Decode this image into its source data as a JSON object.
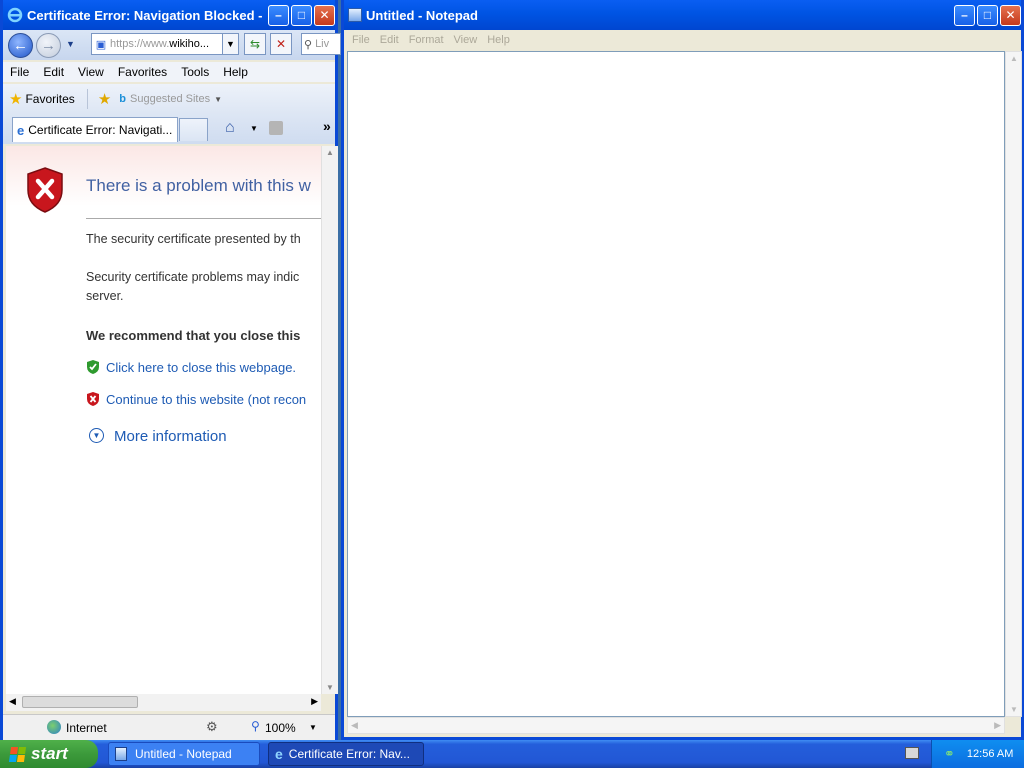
{
  "ie": {
    "title": "Certificate Error: Navigation Blocked - Win...",
    "address": {
      "prefix": "https://www.",
      "domain": "wikiho..."
    },
    "search_placeholder": "Liv",
    "menu": [
      "File",
      "Edit",
      "View",
      "Favorites",
      "Tools",
      "Help"
    ],
    "favorites_label": "Favorites",
    "suggested_sites": "Suggested Sites",
    "tab_title": "Certificate Error: Navigati...",
    "page": {
      "title": "There is a problem with this w",
      "para1": "The security certificate presented by th",
      "para2_line1": "Security certificate problems may indic",
      "para2_line2": "server.",
      "recommend": "We recommend that you close this",
      "link_close": "Click here to close this webpage.",
      "link_continue": "Continue to this website (not recon",
      "more_info": "More information"
    },
    "status": {
      "zone": "Internet",
      "zoom": "100%"
    }
  },
  "notepad": {
    "title": "Untitled - Notepad",
    "menu": [
      "File",
      "Edit",
      "Format",
      "View",
      "Help"
    ]
  },
  "taskbar": {
    "start": "start",
    "tasks": [
      "Untitled - Notepad",
      "Certificate Error: Nav..."
    ],
    "clock": "12:56 AM"
  }
}
